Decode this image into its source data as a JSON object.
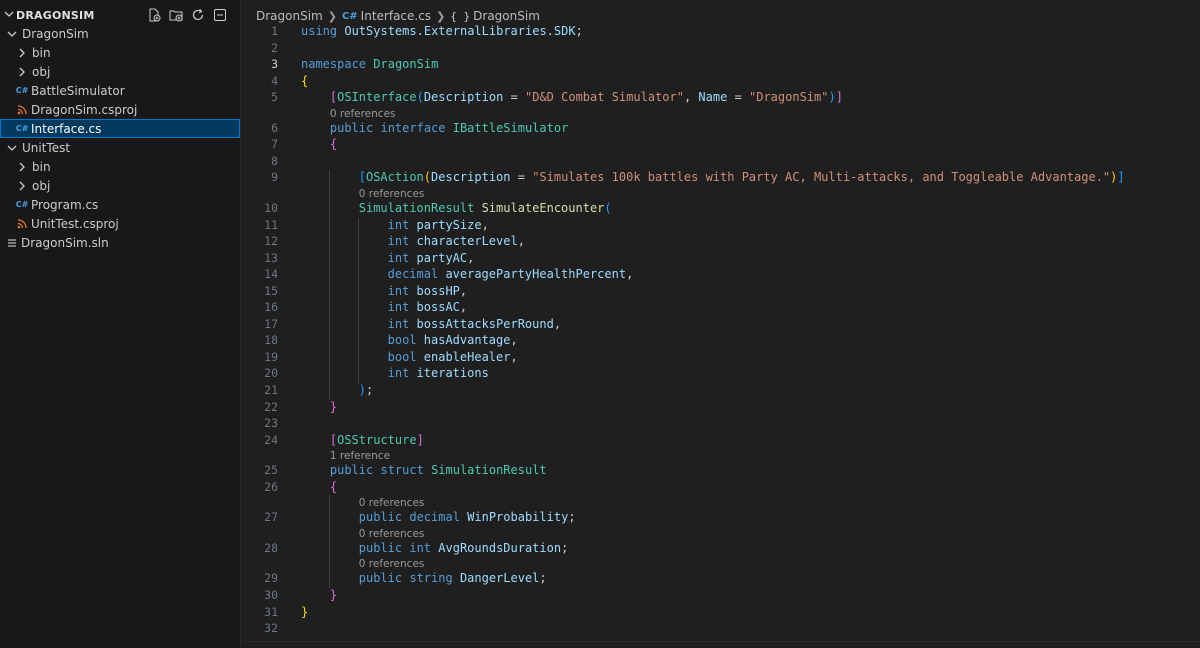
{
  "explorer": {
    "title": "DRAGONSIM",
    "actions": [
      "new-file-icon",
      "new-folder-icon",
      "refresh-icon",
      "collapse-all-icon"
    ],
    "items": [
      {
        "label": "DragonSim",
        "type": "folder",
        "open": true,
        "depth": 0
      },
      {
        "label": "bin",
        "type": "folder",
        "open": false,
        "depth": 1
      },
      {
        "label": "obj",
        "type": "folder",
        "open": false,
        "depth": 1
      },
      {
        "label": "BattleSimulator",
        "type": "cs",
        "depth": 1
      },
      {
        "label": "DragonSim.csproj",
        "type": "proj",
        "depth": 1
      },
      {
        "label": "Interface.cs",
        "type": "cs",
        "depth": 1,
        "selected": true
      },
      {
        "label": "UnitTest",
        "type": "folder",
        "open": true,
        "depth": 0
      },
      {
        "label": "bin",
        "type": "folder",
        "open": false,
        "depth": 1
      },
      {
        "label": "obj",
        "type": "folder",
        "open": false,
        "depth": 1
      },
      {
        "label": "Program.cs",
        "type": "cs",
        "depth": 1
      },
      {
        "label": "UnitTest.csproj",
        "type": "proj",
        "depth": 1
      },
      {
        "label": "DragonSim.sln",
        "type": "sln",
        "depth": 0
      }
    ]
  },
  "breadcrumb": {
    "items": [
      "DragonSim",
      "Interface.cs",
      "DragonSim"
    ]
  },
  "editor": {
    "active_line": 3,
    "lines": [
      {
        "n": 1,
        "indent": 0,
        "tokens": [
          [
            "k",
            "using"
          ],
          [
            "p",
            " "
          ],
          [
            "i",
            "OutSystems"
          ],
          [
            "p",
            "."
          ],
          [
            "i",
            "ExternalLibraries"
          ],
          [
            "p",
            "."
          ],
          [
            "i",
            "SDK"
          ],
          [
            "p",
            ";"
          ]
        ]
      },
      {
        "n": 2,
        "indent": 0,
        "tokens": []
      },
      {
        "n": 3,
        "indent": 0,
        "tokens": [
          [
            "k",
            "namespace"
          ],
          [
            "p",
            " "
          ],
          [
            "ns",
            "DragonSim"
          ]
        ]
      },
      {
        "n": 4,
        "indent": 0,
        "tokens": [
          [
            "b1",
            "{"
          ]
        ]
      },
      {
        "n": 5,
        "indent": 1,
        "tokens": [
          [
            "b2",
            "["
          ],
          [
            "t",
            "OSInterface"
          ],
          [
            "b3",
            "("
          ],
          [
            "i",
            "Description"
          ],
          [
            "p",
            " = "
          ],
          [
            "s",
            "\"D&D Combat Simulator\""
          ],
          [
            "p",
            ", "
          ],
          [
            "i",
            "Name"
          ],
          [
            "p",
            " = "
          ],
          [
            "s",
            "\"DragonSim\""
          ],
          [
            "b3",
            ")"
          ],
          [
            "b2",
            "]"
          ]
        ]
      },
      {
        "lens": "0 references",
        "indent": 1
      },
      {
        "n": 6,
        "indent": 1,
        "tokens": [
          [
            "k",
            "public"
          ],
          [
            "p",
            " "
          ],
          [
            "k",
            "interface"
          ],
          [
            "p",
            " "
          ],
          [
            "t",
            "IBattleSimulator"
          ]
        ]
      },
      {
        "n": 7,
        "indent": 1,
        "tokens": [
          [
            "b2",
            "{"
          ]
        ]
      },
      {
        "n": 8,
        "indent": 0,
        "tokens": []
      },
      {
        "n": 9,
        "indent": 2,
        "tokens": [
          [
            "b3",
            "["
          ],
          [
            "t",
            "OSAction"
          ],
          [
            "b1",
            "("
          ],
          [
            "i",
            "Description"
          ],
          [
            "p",
            " = "
          ],
          [
            "s",
            "\"Simulates 100k battles with Party AC, Multi-attacks, and Toggleable Advantage.\""
          ],
          [
            "b1",
            ")"
          ],
          [
            "b3",
            "]"
          ]
        ]
      },
      {
        "lens": "0 references",
        "indent": 2
      },
      {
        "n": 10,
        "indent": 2,
        "tokens": [
          [
            "t",
            "SimulationResult"
          ],
          [
            "p",
            " "
          ],
          [
            "m",
            "SimulateEncounter"
          ],
          [
            "b3",
            "("
          ]
        ]
      },
      {
        "n": 11,
        "indent": 3,
        "tokens": [
          [
            "k",
            "int"
          ],
          [
            "p",
            " "
          ],
          [
            "i",
            "partySize"
          ],
          [
            "p",
            ","
          ]
        ]
      },
      {
        "n": 12,
        "indent": 3,
        "tokens": [
          [
            "k",
            "int"
          ],
          [
            "p",
            " "
          ],
          [
            "i",
            "characterLevel"
          ],
          [
            "p",
            ","
          ]
        ]
      },
      {
        "n": 13,
        "indent": 3,
        "tokens": [
          [
            "k",
            "int"
          ],
          [
            "p",
            " "
          ],
          [
            "i",
            "partyAC"
          ],
          [
            "p",
            ","
          ]
        ]
      },
      {
        "n": 14,
        "indent": 3,
        "tokens": [
          [
            "k",
            "decimal"
          ],
          [
            "p",
            " "
          ],
          [
            "i",
            "averagePartyHealthPercent"
          ],
          [
            "p",
            ","
          ]
        ]
      },
      {
        "n": 15,
        "indent": 3,
        "tokens": [
          [
            "k",
            "int"
          ],
          [
            "p",
            " "
          ],
          [
            "i",
            "bossHP"
          ],
          [
            "p",
            ","
          ]
        ]
      },
      {
        "n": 16,
        "indent": 3,
        "tokens": [
          [
            "k",
            "int"
          ],
          [
            "p",
            " "
          ],
          [
            "i",
            "bossAC"
          ],
          [
            "p",
            ","
          ]
        ]
      },
      {
        "n": 17,
        "indent": 3,
        "tokens": [
          [
            "k",
            "int"
          ],
          [
            "p",
            " "
          ],
          [
            "i",
            "bossAttacksPerRound"
          ],
          [
            "p",
            ","
          ]
        ]
      },
      {
        "n": 18,
        "indent": 3,
        "tokens": [
          [
            "k",
            "bool"
          ],
          [
            "p",
            " "
          ],
          [
            "i",
            "hasAdvantage"
          ],
          [
            "p",
            ","
          ]
        ]
      },
      {
        "n": 19,
        "indent": 3,
        "tokens": [
          [
            "k",
            "bool"
          ],
          [
            "p",
            " "
          ],
          [
            "i",
            "enableHealer"
          ],
          [
            "p",
            ","
          ]
        ]
      },
      {
        "n": 20,
        "indent": 3,
        "tokens": [
          [
            "k",
            "int"
          ],
          [
            "p",
            " "
          ],
          [
            "i",
            "iterations"
          ]
        ]
      },
      {
        "n": 21,
        "indent": 2,
        "tokens": [
          [
            "b3",
            ")"
          ],
          [
            "p",
            ";"
          ]
        ]
      },
      {
        "n": 22,
        "indent": 1,
        "tokens": [
          [
            "b2",
            "}"
          ]
        ]
      },
      {
        "n": 23,
        "indent": 0,
        "tokens": []
      },
      {
        "n": 24,
        "indent": 1,
        "tokens": [
          [
            "b2",
            "["
          ],
          [
            "t",
            "OSStructure"
          ],
          [
            "b2",
            "]"
          ]
        ]
      },
      {
        "lens": "1 reference",
        "indent": 1
      },
      {
        "n": 25,
        "indent": 1,
        "tokens": [
          [
            "k",
            "public"
          ],
          [
            "p",
            " "
          ],
          [
            "k",
            "struct"
          ],
          [
            "p",
            " "
          ],
          [
            "t",
            "SimulationResult"
          ]
        ]
      },
      {
        "n": 26,
        "indent": 1,
        "tokens": [
          [
            "b2",
            "{"
          ]
        ]
      },
      {
        "lens": "0 references",
        "indent": 2
      },
      {
        "n": 27,
        "indent": 2,
        "tokens": [
          [
            "k",
            "public"
          ],
          [
            "p",
            " "
          ],
          [
            "k",
            "decimal"
          ],
          [
            "p",
            " "
          ],
          [
            "i",
            "WinProbability"
          ],
          [
            "p",
            ";"
          ]
        ]
      },
      {
        "lens": "0 references",
        "indent": 2
      },
      {
        "n": 28,
        "indent": 2,
        "tokens": [
          [
            "k",
            "public"
          ],
          [
            "p",
            " "
          ],
          [
            "k",
            "int"
          ],
          [
            "p",
            " "
          ],
          [
            "i",
            "AvgRoundsDuration"
          ],
          [
            "p",
            ";"
          ]
        ]
      },
      {
        "lens": "0 references",
        "indent": 2
      },
      {
        "n": 29,
        "indent": 2,
        "tokens": [
          [
            "k",
            "public"
          ],
          [
            "p",
            " "
          ],
          [
            "k",
            "string"
          ],
          [
            "p",
            " "
          ],
          [
            "i",
            "DangerLevel"
          ],
          [
            "p",
            ";"
          ]
        ]
      },
      {
        "n": 30,
        "indent": 1,
        "tokens": [
          [
            "b2",
            "}"
          ]
        ]
      },
      {
        "n": 31,
        "indent": 0,
        "tokens": [
          [
            "b1",
            "}"
          ]
        ]
      },
      {
        "n": 32,
        "indent": 0,
        "tokens": []
      }
    ]
  }
}
